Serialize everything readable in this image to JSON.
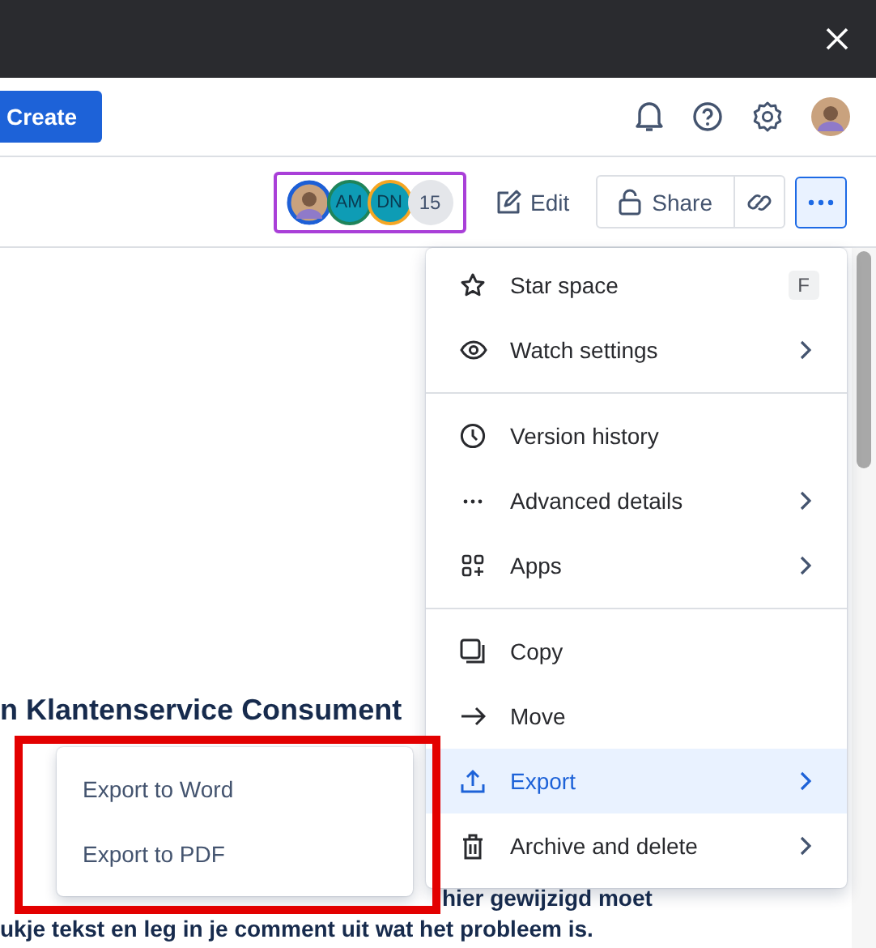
{
  "header": {
    "create_button": "Create"
  },
  "toolbar": {
    "collaborators": [
      {
        "kind": "photo",
        "color": "#1d5fd6"
      },
      {
        "kind": "initials",
        "initials": "AM",
        "color": "#1f845a"
      },
      {
        "kind": "initials",
        "initials": "DN",
        "color": "#f5a623"
      }
    ],
    "more_count": "15",
    "edit": "Edit",
    "share": "Share",
    "more_selected": true
  },
  "document": {
    "heading": "n Klantenservice Consument",
    "partial_line": "hier gewijzigd moet",
    "line": "ukje tekst en leg in je comment uit wat het probleem is."
  },
  "menu": {
    "sections": [
      [
        {
          "label": "Star space",
          "shortcut": "F",
          "submenu": false,
          "selected": false
        },
        {
          "label": "Watch settings",
          "submenu": true,
          "selected": false
        }
      ],
      [
        {
          "label": "Version history",
          "submenu": false,
          "selected": false
        },
        {
          "label": "Advanced details",
          "submenu": true,
          "selected": false
        },
        {
          "label": "Apps",
          "submenu": true,
          "selected": false
        }
      ],
      [
        {
          "label": "Copy",
          "submenu": false,
          "selected": false
        },
        {
          "label": "Move",
          "submenu": false,
          "selected": false
        },
        {
          "label": "Export",
          "submenu": true,
          "selected": true
        },
        {
          "label": "Archive and delete",
          "submenu": true,
          "selected": false
        }
      ]
    ]
  },
  "submenu": {
    "items": [
      "Export to Word",
      "Export to PDF"
    ]
  },
  "annotation": {
    "highlight": true
  }
}
